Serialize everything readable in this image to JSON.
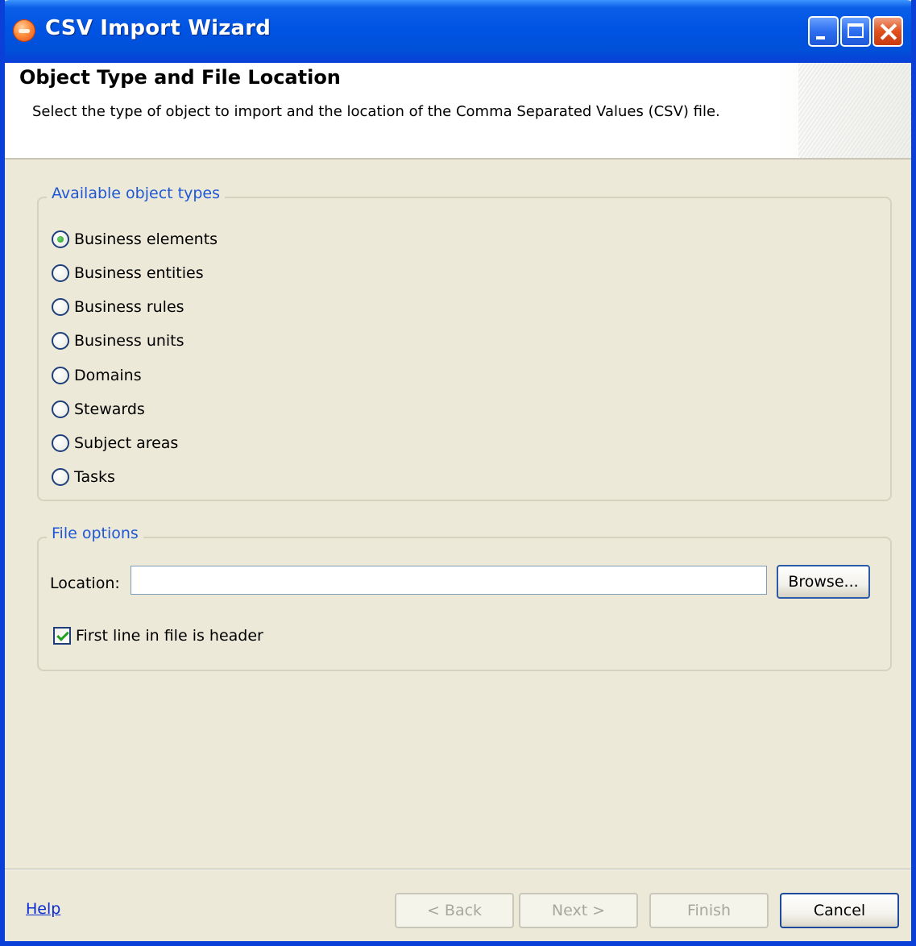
{
  "window": {
    "title": "CSV Import Wizard",
    "icon": "csv-wizard-app-icon"
  },
  "header": {
    "title": "Object Type and File Location",
    "description": "Select the type of object to import and the location of the Comma Separated Values (CSV) file."
  },
  "object_types": {
    "legend": "Available object types",
    "selected": "Business elements",
    "options": [
      {
        "label": "Business elements",
        "checked": true
      },
      {
        "label": "Business entities",
        "checked": false
      },
      {
        "label": "Business rules",
        "checked": false
      },
      {
        "label": "Business units",
        "checked": false
      },
      {
        "label": "Domains",
        "checked": false
      },
      {
        "label": "Stewards",
        "checked": false
      },
      {
        "label": "Subject areas",
        "checked": false
      },
      {
        "label": "Tasks",
        "checked": false
      }
    ]
  },
  "file_options": {
    "legend": "File options",
    "location_label": "Location:",
    "location_value": "",
    "browse_label": "Browse...",
    "header_checkbox_label": "First line in file is header",
    "header_checkbox_checked": true
  },
  "footer": {
    "help_label": "Help",
    "back_label": "< Back",
    "next_label": "Next >",
    "finish_label": "Finish",
    "cancel_label": "Cancel"
  },
  "colors": {
    "titlebar": "#0054e3",
    "dialog_bg": "#ece9d8",
    "legend_text": "#1f58d6",
    "link": "#0a2bd0"
  }
}
